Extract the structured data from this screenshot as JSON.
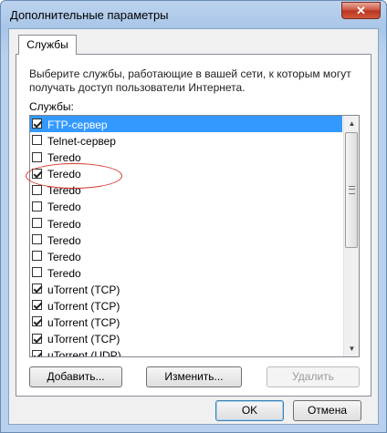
{
  "window": {
    "title": "Дополнительные параметры",
    "close_glyph": "✕"
  },
  "tabs": [
    {
      "label": "Службы"
    }
  ],
  "panel": {
    "description": "Выберите службы, работающие в вашей сети, к которым могут получать доступ пользователи Интернета.",
    "services_label": "Службы:"
  },
  "services": [
    {
      "label": "FTP-сервер",
      "checked": true,
      "selected": true
    },
    {
      "label": "Telnet-сервер",
      "checked": false,
      "selected": false
    },
    {
      "label": "Teredo",
      "checked": false,
      "selected": false
    },
    {
      "label": "Teredo",
      "checked": true,
      "selected": false,
      "annotated": true
    },
    {
      "label": "Teredo",
      "checked": false,
      "selected": false
    },
    {
      "label": "Teredo",
      "checked": false,
      "selected": false
    },
    {
      "label": "Teredo",
      "checked": false,
      "selected": false
    },
    {
      "label": "Teredo",
      "checked": false,
      "selected": false
    },
    {
      "label": "Teredo",
      "checked": false,
      "selected": false
    },
    {
      "label": "Teredo",
      "checked": false,
      "selected": false
    },
    {
      "label": "uTorrent (TCP)",
      "checked": true,
      "selected": false
    },
    {
      "label": "uTorrent (TCP)",
      "checked": true,
      "selected": false
    },
    {
      "label": "uTorrent (TCP)",
      "checked": true,
      "selected": false
    },
    {
      "label": "uTorrent (TCP)",
      "checked": true,
      "selected": false
    },
    {
      "label": "uTorrent (UDP)",
      "checked": true,
      "selected": false
    }
  ],
  "scrollbar": {
    "up_icon": "▲",
    "down_icon": "▼"
  },
  "buttons": {
    "add": "Добавить...",
    "edit": "Изменить...",
    "delete": "Удалить",
    "ok": "OK",
    "cancel": "Отмена"
  },
  "colors": {
    "selection": "#3399ff",
    "annotation": "#d8352b"
  }
}
